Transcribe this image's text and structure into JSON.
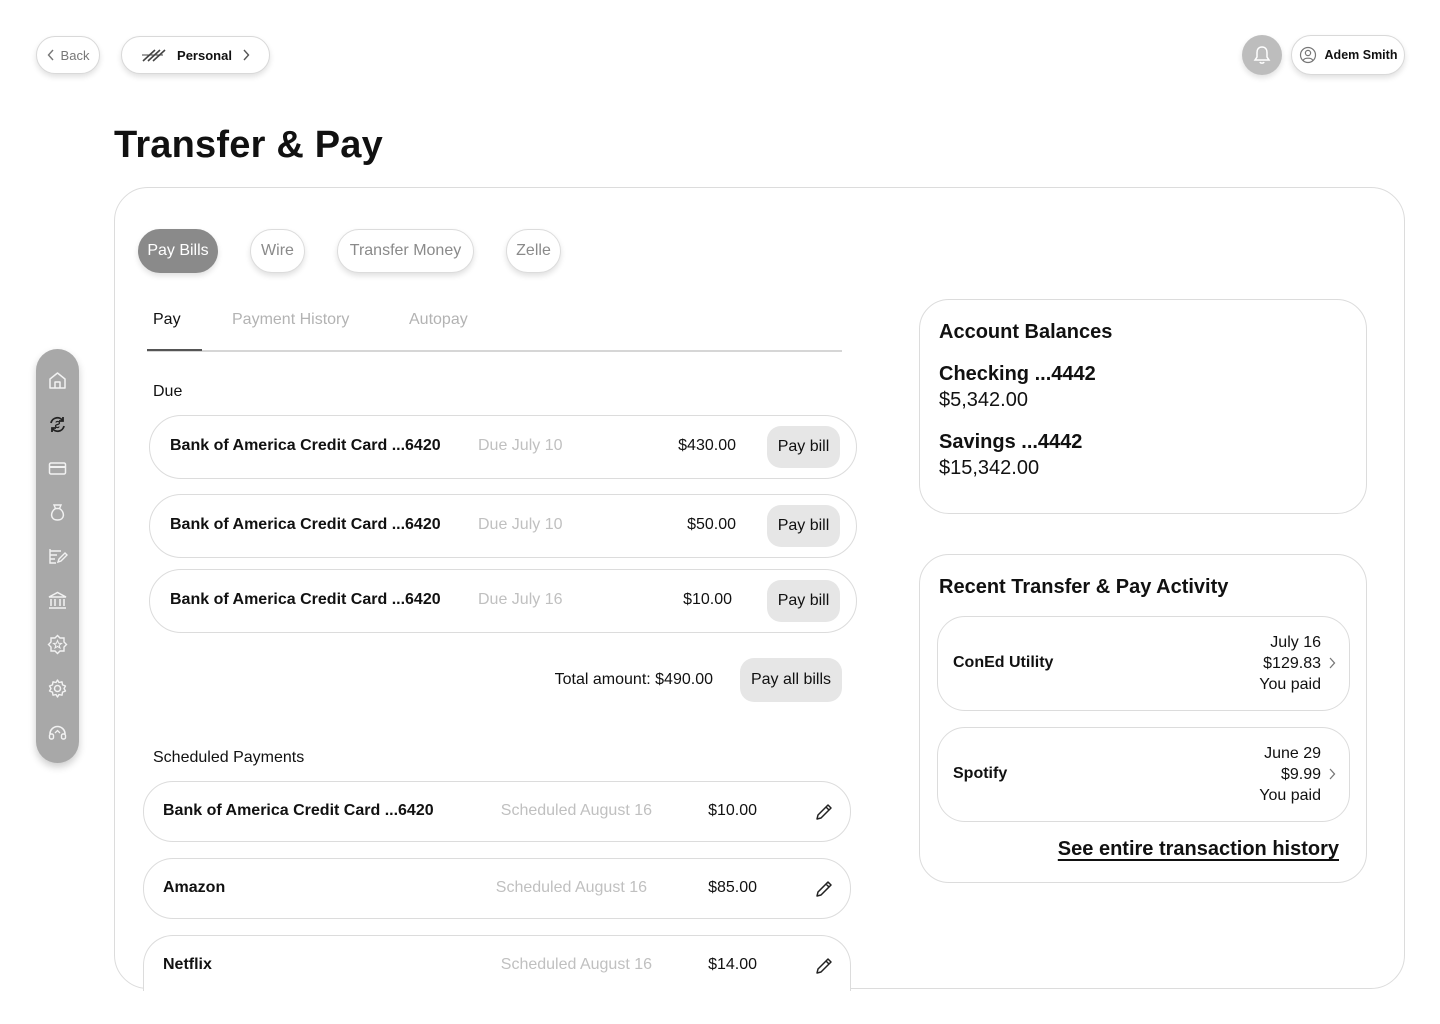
{
  "header": {
    "back_label": "Back",
    "account_switcher_label": "Personal",
    "user_name": "Adem Smith"
  },
  "page_title": "Transfer & Pay",
  "type_tabs": [
    {
      "label": "Pay Bills",
      "active": true
    },
    {
      "label": "Wire",
      "active": false
    },
    {
      "label": "Transfer Money",
      "active": false
    },
    {
      "label": "Zelle",
      "active": false
    }
  ],
  "sub_tabs": [
    {
      "label": "Pay",
      "active": true
    },
    {
      "label": "Payment History",
      "active": false
    },
    {
      "label": "Autopay",
      "active": false
    }
  ],
  "due": {
    "label": "Due",
    "bills": [
      {
        "name": "Bank of America Credit Card ...6420",
        "due": "Due July 10",
        "amount": "$430.00",
        "action": "Pay bill"
      },
      {
        "name": "Bank of America Credit Card ...6420",
        "due": "Due July 10",
        "amount": "$50.00",
        "action": "Pay bill"
      },
      {
        "name": "Bank of America Credit Card ...6420",
        "due": "Due July 16",
        "amount": "$10.00",
        "action": "Pay bill"
      }
    ],
    "total_label": "Total amount: $490.00",
    "pay_all_label": "Pay all bills"
  },
  "scheduled": {
    "label": "Scheduled Payments",
    "payments": [
      {
        "name": "Bank of America Credit Card ...6420",
        "date": "Scheduled August 16",
        "amount": "$10.00"
      },
      {
        "name": "Amazon",
        "date": "Scheduled August 16",
        "amount": "$85.00"
      },
      {
        "name": "Netflix",
        "date": "Scheduled August 16",
        "amount": "$14.00"
      }
    ]
  },
  "side_nav": {
    "items": [
      "home-icon",
      "transfer-icon",
      "card-icon",
      "money-bag-icon",
      "bill-pay-icon",
      "bank-icon",
      "star-badge-icon",
      "settings-icon",
      "support-icon"
    ]
  },
  "balances": {
    "title": "Account Balances",
    "accounts": [
      {
        "name": "Checking ...4442",
        "balance": "$5,342.00"
      },
      {
        "name": "Savings ...4442",
        "balance": "$15,342.00"
      }
    ]
  },
  "activity": {
    "title": "Recent Transfer & Pay Activity",
    "items": [
      {
        "name": "ConEd Utility",
        "date": "July 16",
        "amount": "$129.83",
        "status": "You paid"
      },
      {
        "name": "Spotify",
        "date": "June 29",
        "amount": "$9.99",
        "status": "You paid"
      }
    ],
    "history_link": "See entire transaction history"
  },
  "colors": {
    "active_tab": "#8a8a8a",
    "side_nav": "#a8a8a8",
    "muted_text": "#c0c0c0",
    "button_fill": "#e6e6e6"
  }
}
